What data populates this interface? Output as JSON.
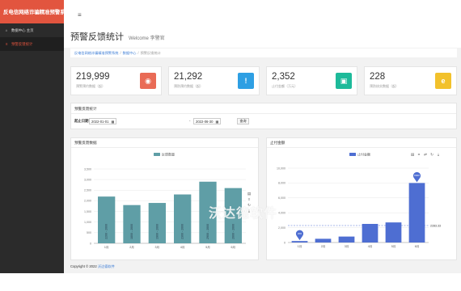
{
  "app": {
    "brand": "反电信网络诈骗精准预警系统"
  },
  "sidebar": {
    "items": [
      {
        "label": "数据中心 主页",
        "icon": "home-icon"
      },
      {
        "label": "预警反馈统计",
        "icon": "list-icon"
      }
    ]
  },
  "header": {
    "title": "预警反馈统计",
    "welcome": "Welcome 李警官"
  },
  "breadcrumb": [
    "反电信网络诈骗精准预警系统",
    "数据中心",
    "预警反馈统计"
  ],
  "cards": [
    {
      "value": "219,999",
      "label": "预警预约数据（起）",
      "color": "#e96b56",
      "icon": "eye-icon",
      "glyph": "◉"
    },
    {
      "value": "21,292",
      "label": "预防预约数据（起）",
      "color": "#2e9fe3",
      "icon": "warning-icon",
      "glyph": "!"
    },
    {
      "value": "2,352",
      "label": "止付金额（万元）",
      "color": "#1dba9a",
      "icon": "money-icon",
      "glyph": "▣"
    },
    {
      "value": "228",
      "label": "预防核实数据（起）",
      "color": "#f2c12b",
      "icon": "ie-icon",
      "glyph": "e"
    }
  ],
  "filter": {
    "title": "预警反馈统计",
    "date_label": "起止日期",
    "start": "2022-01-01",
    "end": "2022-06-30",
    "query_label": "查询"
  },
  "panels": {
    "left_title": "预警反馈数据",
    "right_title": "止付金额"
  },
  "footer": {
    "text": "Copyright © 2022 ",
    "link": "沃达德软件"
  },
  "watermark": "沃达德软件",
  "chart_data": [
    {
      "type": "bar",
      "legend": [
        "反馈数量"
      ],
      "categories": [
        "1月",
        "2月",
        "3月",
        "4月",
        "5月",
        "6月"
      ],
      "series": [
        {
          "name": "反馈数量",
          "values": [
            2200,
            1800,
            1900,
            2300,
            2900,
            2600
          ],
          "color": "#5f9ea6"
        }
      ],
      "data_labels": [
        "2200 - 2000",
        "1800 - 2000",
        "1900 - 2000",
        "2300 - 2000",
        "2900 - 2000",
        "2600 - 2000"
      ],
      "yticks": [
        "0",
        "500",
        "1,000",
        "1,500",
        "2,000",
        "2,500",
        "3,000",
        "3,500"
      ],
      "ylim": [
        0,
        3500
      ],
      "legend_position": "top-center",
      "grid": true
    },
    {
      "type": "bar",
      "legend": [
        "止付金额"
      ],
      "categories": [
        "1月",
        "2月",
        "3月",
        "4月",
        "5月",
        "6月"
      ],
      "series": [
        {
          "name": "止付金额",
          "values": [
            200,
            500,
            800,
            2500,
            2700,
            8000
          ],
          "color": "#4e6ed2"
        }
      ],
      "markers": [
        {
          "index": 0,
          "label": "200"
        },
        {
          "index": 5,
          "label": "8000"
        }
      ],
      "average_line": {
        "value": 2283.33,
        "label": "2283.33"
      },
      "yticks": [
        "0",
        "2,000",
        "4,000",
        "6,000",
        "8,000",
        "10,000"
      ],
      "ylim": [
        0,
        10000
      ],
      "legend_position": "top-center",
      "grid": true
    }
  ]
}
